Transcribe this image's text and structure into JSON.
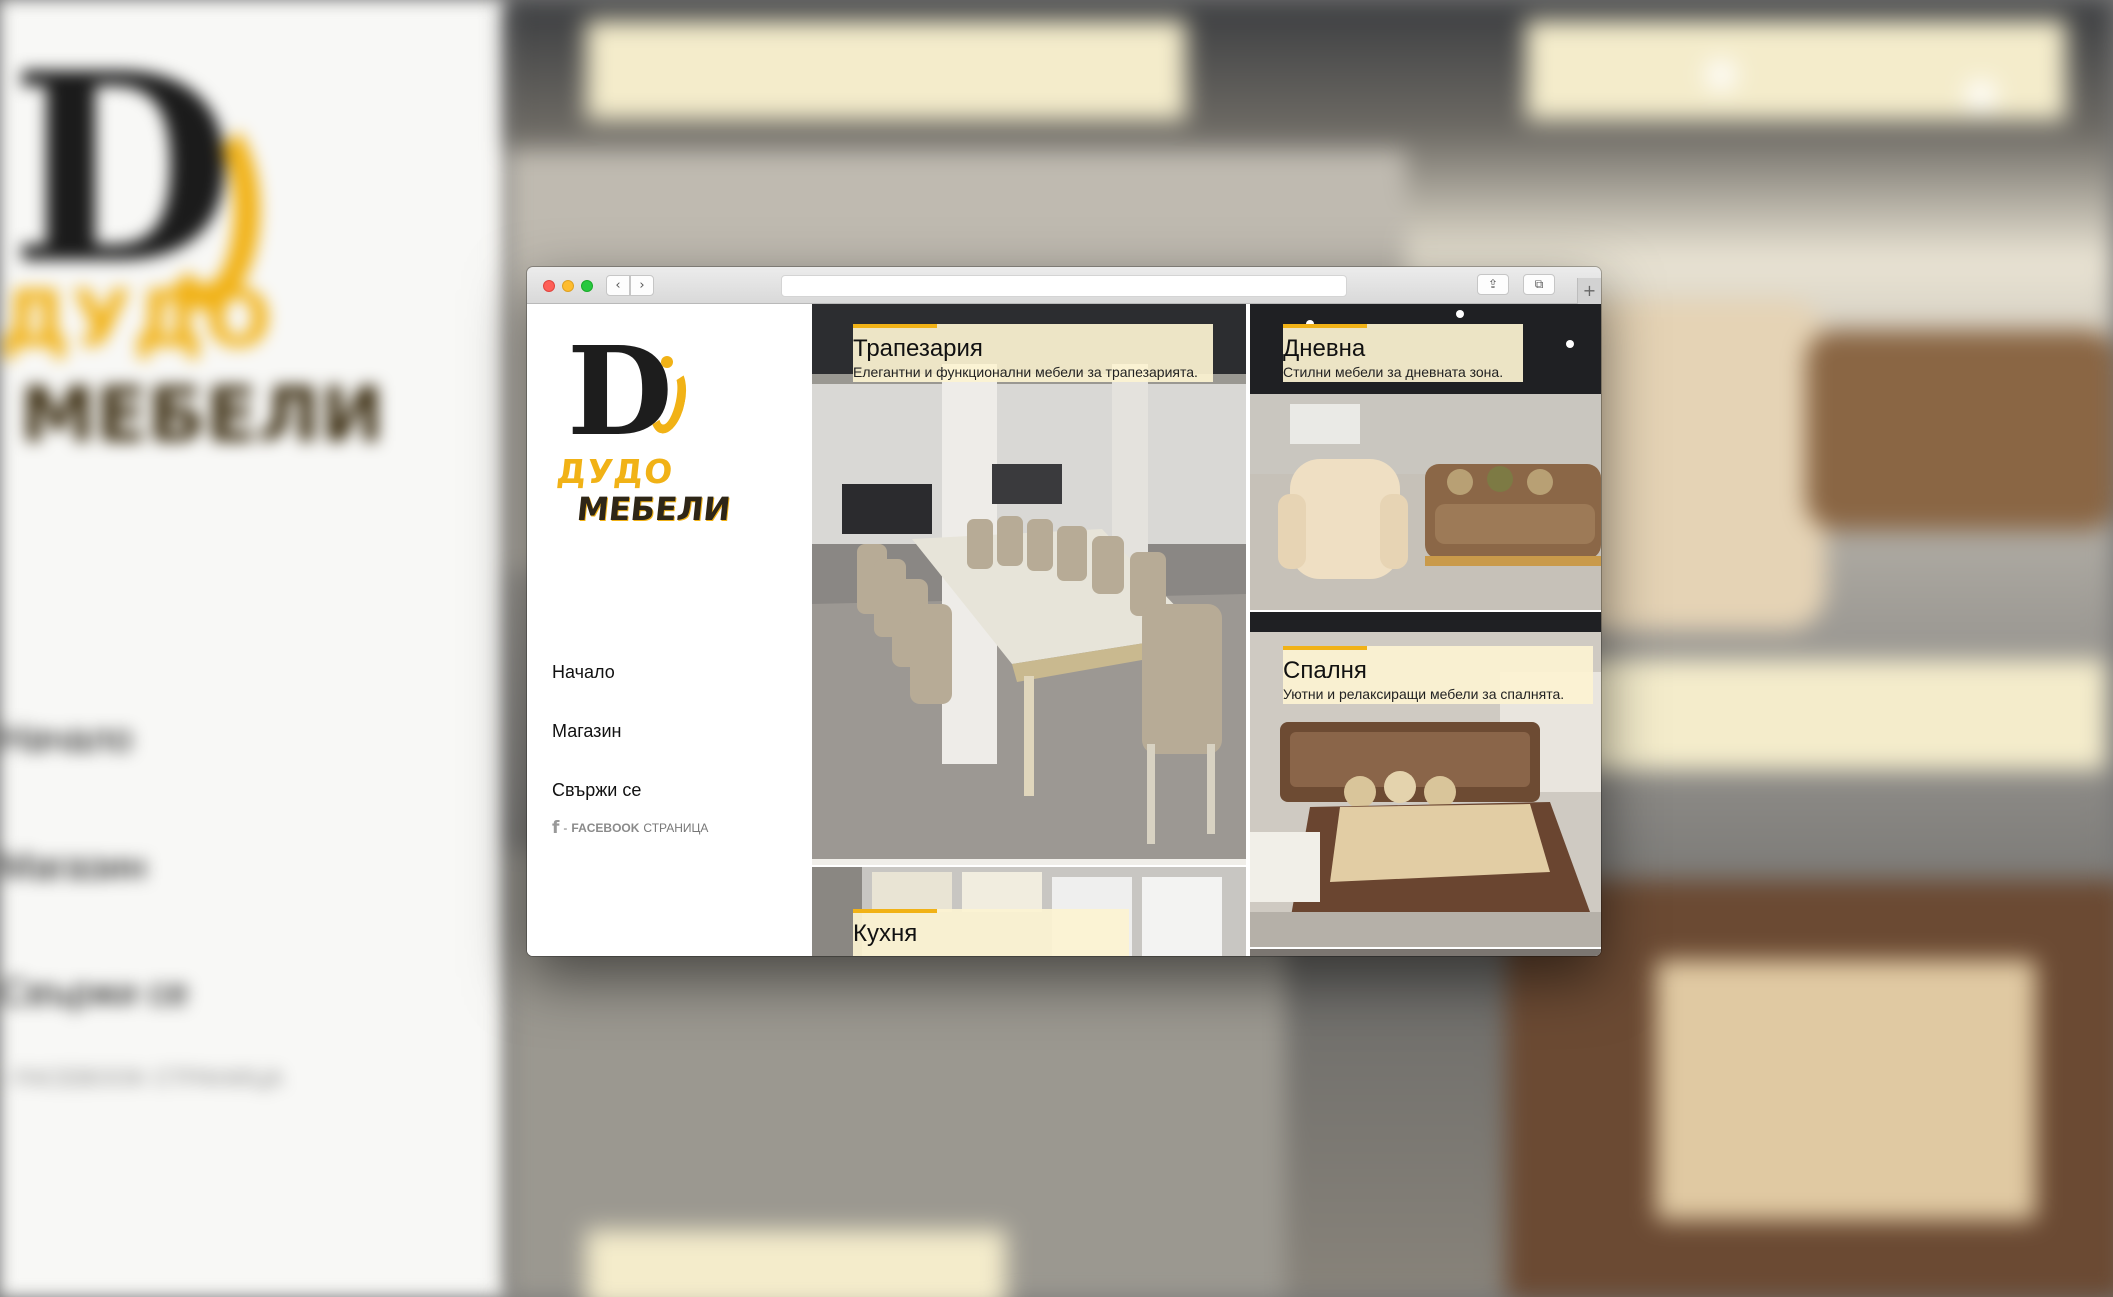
{
  "brand": {
    "line1": "ДУДО",
    "line2": "МЕБЕЛИ",
    "logo_letter": "D",
    "colors": {
      "accent": "#f1b216",
      "dark": "#1d1d1d"
    }
  },
  "browser": {
    "back_icon": "‹",
    "forward_icon": "›",
    "share_icon": "⇪",
    "tabs_icon": "⧉",
    "new_tab_icon": "+"
  },
  "nav": {
    "items": [
      {
        "label": "Начало"
      },
      {
        "label": "Магазин"
      },
      {
        "label": "Свържи се"
      }
    ],
    "facebook": {
      "icon": "f",
      "prefix": "- ",
      "strong": "FACEBOOK",
      "rest": " СТРАНИЦА"
    }
  },
  "tiles": [
    {
      "title": "Трапезария",
      "description": "Елегантни и функционални мебели за трапезарията."
    },
    {
      "title": "Дневна",
      "description": "Стилни мебели за дневната зона."
    },
    {
      "title": "Спалня",
      "description": "Уютни и релаксиращи мебели за спалнята."
    },
    {
      "title": "Кухня",
      "description": ""
    }
  ],
  "backdrop": {
    "nav_items": [
      "Начало",
      "Магазин",
      "Свържи се"
    ],
    "facebook_line": "- FACEBOOK СТРАНИЦА"
  }
}
